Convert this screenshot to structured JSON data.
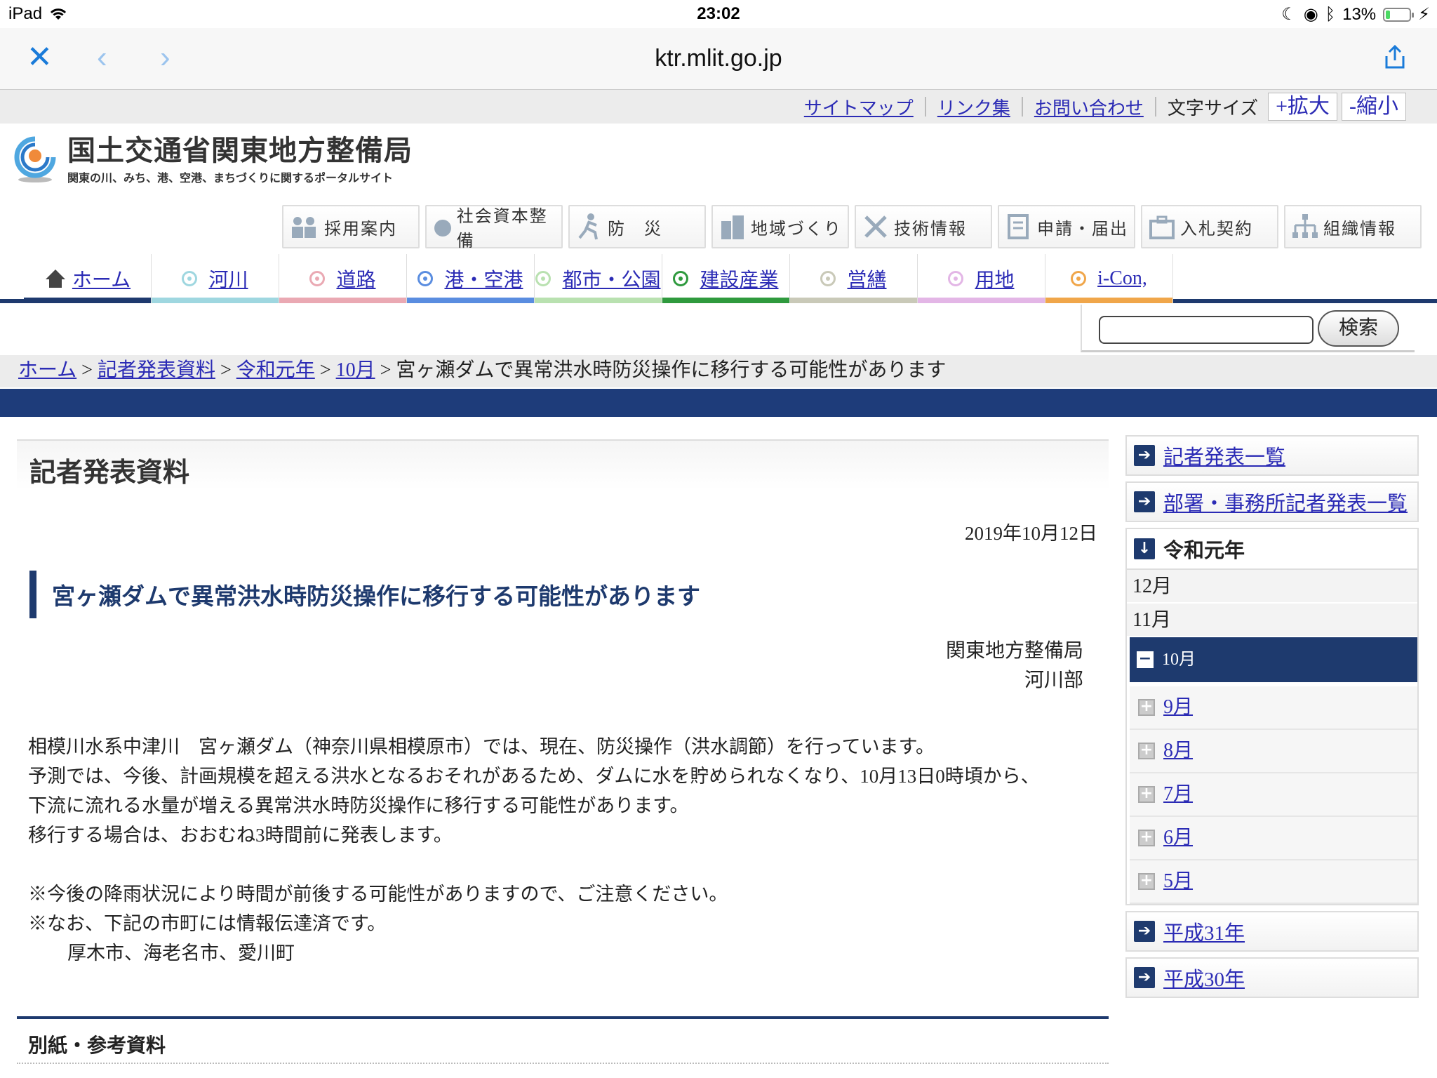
{
  "status": {
    "device": "iPad",
    "time": "23:02",
    "battery": "13%"
  },
  "browser": {
    "url": "ktr.mlit.go.jp"
  },
  "util": {
    "sitemap": "サイトマップ",
    "links": "リンク集",
    "contact": "お問い合わせ",
    "font_size_label": "文字サイズ",
    "enlarge": "+拡大",
    "shrink": "-縮小"
  },
  "logo": {
    "title": "国土交通省関東地方整備局",
    "subtitle": "関東の川、みち、港、空港、まちづくりに関するポータルサイト"
  },
  "categories": [
    "採用案内",
    "社会資本整備",
    "防　災",
    "地域づくり",
    "技術情報",
    "申請・届出",
    "入札契約",
    "組織情報"
  ],
  "tabs": [
    {
      "label": "ホーム",
      "color": "#1e3a6e"
    },
    {
      "label": "河川",
      "color": "#9fd7e0"
    },
    {
      "label": "道路",
      "color": "#eaa9b3"
    },
    {
      "label": "港・空港",
      "color": "#5a8de0"
    },
    {
      "label": "都市・公園",
      "color": "#b9e1b0"
    },
    {
      "label": "建設産業",
      "color": "#2f9a3e"
    },
    {
      "label": "営繕",
      "color": "#c9c9b8"
    },
    {
      "label": "用地",
      "color": "#e3b6e6"
    },
    {
      "label": "i-Con,",
      "color": "#f0a64a"
    }
  ],
  "search": {
    "button": "検索",
    "value": ""
  },
  "breadcrumb": {
    "home": "ホーム",
    "press": "記者発表資料",
    "year": "令和元年",
    "month": "10月",
    "current": "宮ヶ瀬ダムで異常洪水時防災操作に移行する可能性があります",
    "sep": ">"
  },
  "main": {
    "section_title": "記者発表資料",
    "date": "2019年10月12日",
    "headline": "宮ヶ瀬ダムで異常洪水時防災操作に移行する可能性があります",
    "org1": "関東地方整備局",
    "org2": "河川部",
    "p1": "相模川水系中津川　宮ヶ瀬ダム（神奈川県相模原市）では、現在、防災操作（洪水調節）を行っています。",
    "p2": "予測では、今後、計画規模を超える洪水となるおそれがあるため、ダムに水を貯められなくなり、10月13日0時頃から、",
    "p3": "下流に流れる水量が増える異常洪水時防災操作に移行する可能性があります。",
    "p4": "移行する場合は、おおむね3時間前に発表します。",
    "n1": "※今後の降雨状況により時間が前後する可能性がありますので、ご注意ください。",
    "n2": "※なお、下記の市町には情報伝達済です。",
    "n3": "厚木市、海老名市、愛川町",
    "attach": "別紙・参考資料"
  },
  "sidebar": {
    "list_all": "記者発表一覧",
    "list_dept": "部署・事務所記者発表一覧",
    "year": "令和元年",
    "plain_months": [
      "12月",
      "11月"
    ],
    "active_month": "10月",
    "months": [
      "9月",
      "8月",
      "7月",
      "6月",
      "5月"
    ],
    "h31": "平成31年",
    "h30": "平成30年"
  }
}
